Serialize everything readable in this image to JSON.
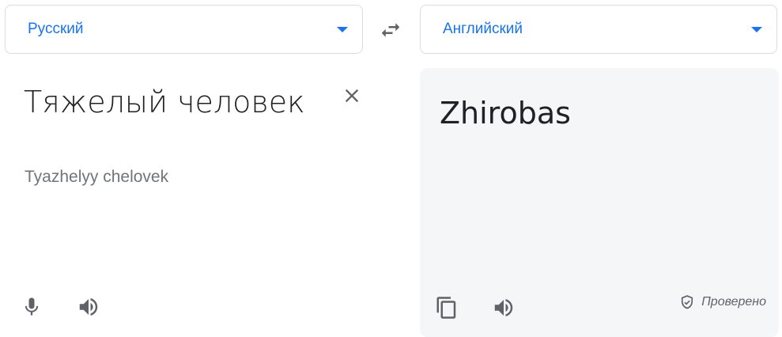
{
  "source_language": {
    "label": "Русский"
  },
  "target_language": {
    "label": "Английский"
  },
  "source": {
    "text": "Тяжелый человек",
    "transliteration": "Tyazhelyy chelovek"
  },
  "target": {
    "text": "Zhirobas",
    "verified_label": "Проверено"
  },
  "icons": {
    "swap": "swap-icon",
    "dropdown": "chevron-down-icon",
    "clear": "close-icon",
    "mic": "mic-icon",
    "speaker": "speaker-icon",
    "copy": "copy-icon",
    "shield": "shield-check-icon"
  },
  "colors": {
    "accent": "#1a73e8",
    "icon": "#5f6368",
    "target_background": "#f5f6f8"
  }
}
